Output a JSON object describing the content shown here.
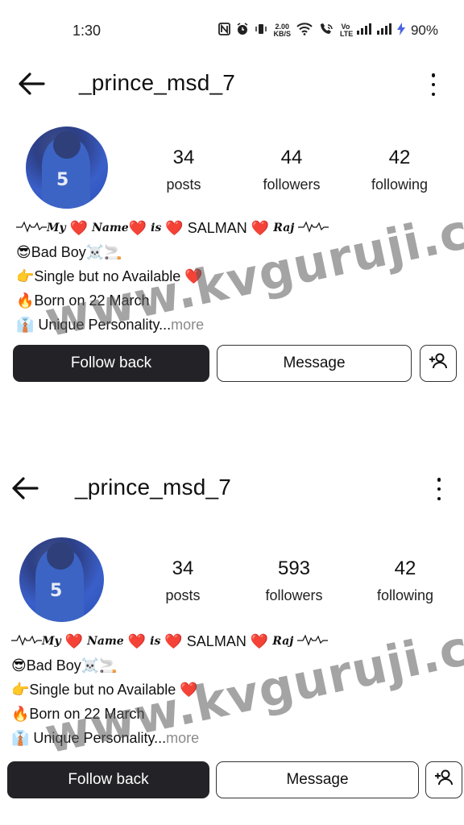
{
  "status_bar": {
    "time": "1:30",
    "network_speed_value": "2.00",
    "network_speed_unit": "KB/S",
    "volte_label": "Vo LTE",
    "battery": "90%"
  },
  "profiles": [
    {
      "username": "_prince_msd_7",
      "avatar_number": "5",
      "stats": [
        {
          "count": "34",
          "label": "posts"
        },
        {
          "count": "44",
          "label": "followers"
        },
        {
          "count": "42",
          "label": "following"
        }
      ],
      "bio": {
        "line1_a": "My",
        "line1_b": "Name",
        "line1_c": "is",
        "line1_name": "SALMAN",
        "line1_d": "Raj",
        "line2": "😎Bad Boy☠️🚬",
        "line3": "👉Single but no Available ❤️",
        "line4": "🔥Born on 22 March",
        "line5": "👔 Unique Personality...",
        "more": "more"
      },
      "buttons": {
        "follow_back": "Follow back",
        "message": "Message"
      }
    },
    {
      "username": "_prince_msd_7",
      "avatar_number": "5",
      "stats": [
        {
          "count": "34",
          "label": "posts"
        },
        {
          "count": "593",
          "label": "followers"
        },
        {
          "count": "42",
          "label": "following"
        }
      ],
      "bio": {
        "line1_a": "My",
        "line1_b": "Name",
        "line1_c": "is",
        "line1_name": "SALMAN",
        "line1_d": "Raj",
        "line2": "😎Bad Boy☠️🚬",
        "line3": "👉Single but no Available ❤️",
        "line4": "🔥Born on 22 March",
        "line5": "👔 Unique Personality...",
        "more": "more"
      },
      "buttons": {
        "follow_back": "Follow back",
        "message": "Message"
      }
    }
  ],
  "watermark": "www.kvguruji.com",
  "colors": {
    "heart": "#e0262b",
    "button_dark": "#222227"
  }
}
